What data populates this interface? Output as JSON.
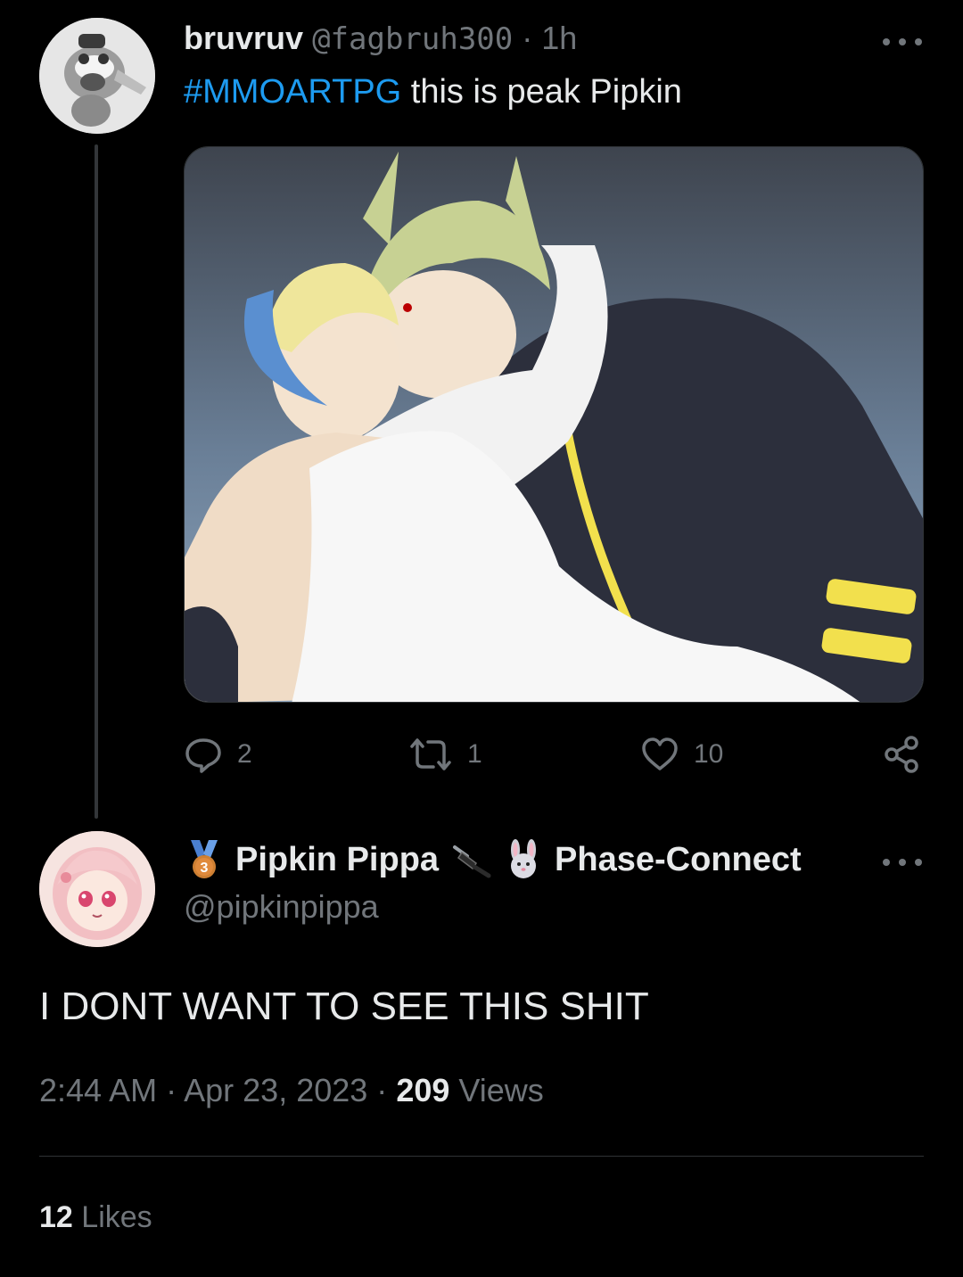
{
  "tweet": {
    "author_name": "bruvruv",
    "author_handle": "@fagbruh300",
    "separator": "·",
    "time": "1h",
    "hashtag": "#MMOARTPG",
    "text": "this is peak Pipkin",
    "reply_count": "2",
    "retweet_count": "1",
    "like_count": "10",
    "media_icon": "anime-illustration"
  },
  "reply": {
    "author_name": "Pipkin Pippa",
    "name_suffix": "Phase-Connect",
    "author_handle": "@pipkinpippa",
    "text": "I DONT WANT TO SEE THIS SHIT",
    "time": "2:44 AM",
    "separator": "·",
    "date": "Apr 23, 2023",
    "views_count": "209",
    "views_label": "Views",
    "likes_count": "12",
    "likes_label": "Likes",
    "badge_icon": "bronze-medal-icon",
    "plug_icon": "plug-icon",
    "rabbit_icon": "rabbit-icon"
  },
  "colors": {
    "background": "#000000",
    "text_primary": "#e7e9ea",
    "text_secondary": "#71767b",
    "hashtag": "#1d9bf0",
    "divider": "#2f3336"
  }
}
